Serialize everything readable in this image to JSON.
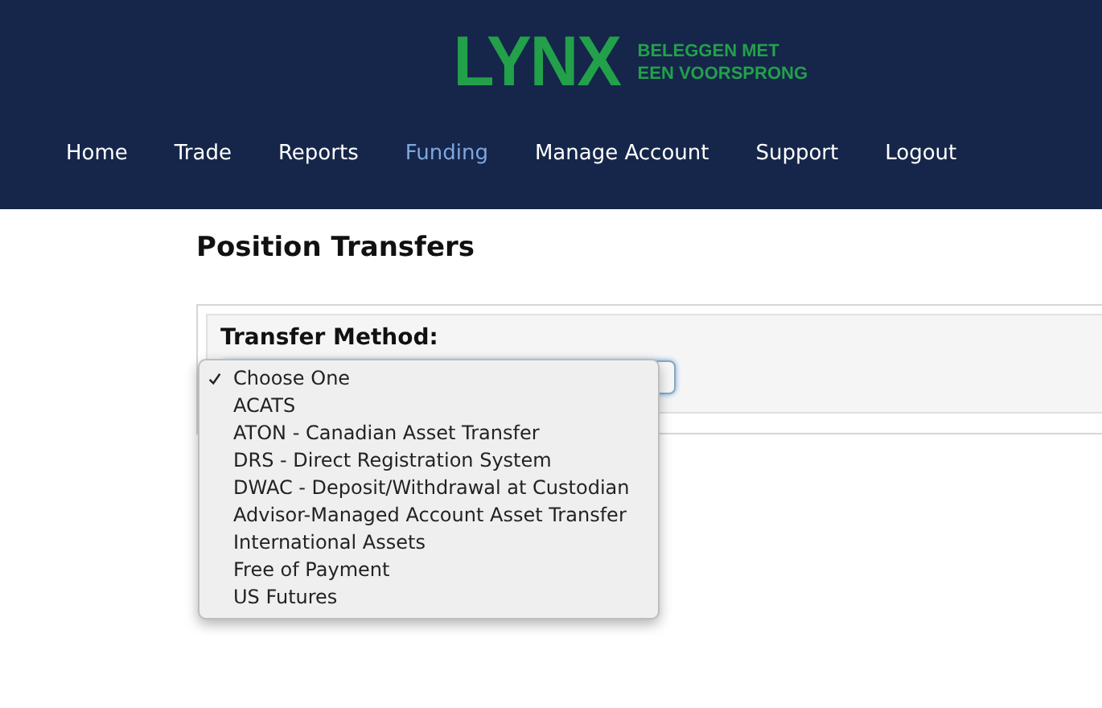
{
  "logo": {
    "wordmark": "LYNX",
    "tagline": [
      "BELEGGEN MET",
      "EEN VOORSPRONG"
    ]
  },
  "nav": [
    {
      "label": "Home",
      "selected": false
    },
    {
      "label": "Trade",
      "selected": false
    },
    {
      "label": "Reports",
      "selected": false
    },
    {
      "label": "Funding",
      "selected": true
    },
    {
      "label": "Manage Account",
      "selected": false
    },
    {
      "label": "Support",
      "selected": false
    },
    {
      "label": "Logout",
      "selected": false
    }
  ],
  "page_title": "Position Transfers",
  "form": {
    "label": "Transfer Method:",
    "dropdown": {
      "expanded": true,
      "options": [
        {
          "label": "Choose One",
          "selected": true
        },
        {
          "label": "ACATS",
          "selected": false
        },
        {
          "label": "ATON - Canadian Asset Transfer",
          "selected": false
        },
        {
          "label": "DRS - Direct Registration System",
          "selected": false
        },
        {
          "label": "DWAC - Deposit/Withdrawal at Custodian",
          "selected": false
        },
        {
          "label": "Advisor-Managed Account Asset Transfer",
          "selected": false
        },
        {
          "label": "International Assets",
          "selected": false
        },
        {
          "label": "Free of Payment",
          "selected": false
        },
        {
          "label": "US Futures",
          "selected": false
        }
      ]
    }
  }
}
